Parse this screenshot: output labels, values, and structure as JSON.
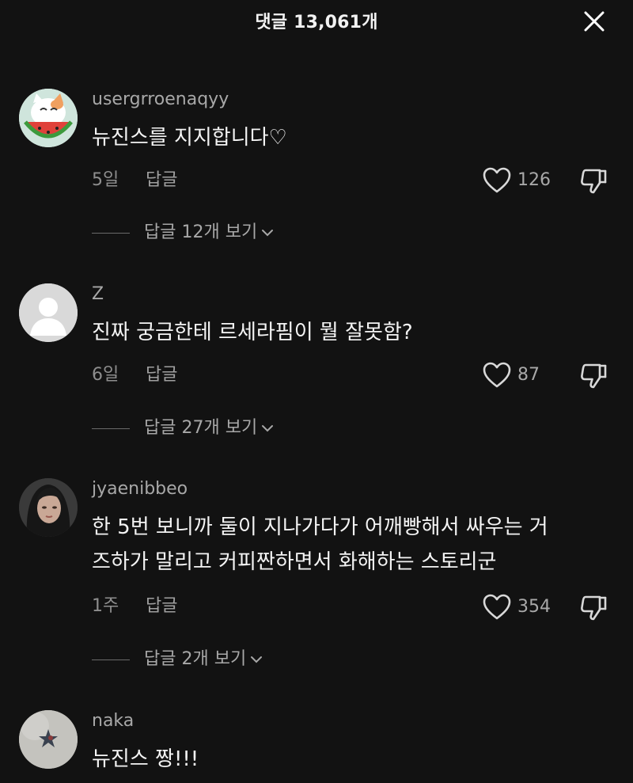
{
  "header": {
    "title": "댓글 13,061개"
  },
  "comments": [
    {
      "username": "usergrroenaqyy",
      "avatar": "watermelon-cat-icon",
      "text": "뉴진스를 지지합니다♡",
      "time": "5일",
      "reply_label": "답글",
      "likes": "126",
      "view_replies": "답글 12개 보기"
    },
    {
      "username": "Z",
      "avatar": "default-user-icon",
      "text": "진짜 궁금한테 르세라핌이 뭘 잘못함?",
      "time": "6일",
      "reply_label": "답글",
      "likes": "87",
      "view_replies": "답글 27개 보기"
    },
    {
      "username": "jyaenibbeo",
      "avatar": "profile-photo",
      "text": "한 5번 보니까 둘이 지나가다가 어깨빵해서 싸우는 거즈하가 말리고 커피짠하면서 화해하는 스토리군",
      "text_line1": "한 5번 보니까 둘이 지나가다가 어깨빵해서 싸우는 거",
      "text_line2": "즈하가 말리고 커피짠하면서 화해하는 스토리군",
      "time": "1주",
      "reply_label": "답글",
      "likes": "354",
      "view_replies": "답글 2개 보기"
    },
    {
      "username": "naka",
      "avatar": "star-sticker-photo",
      "text": "뉴진스 짱!!!"
    }
  ],
  "colors": {
    "background": "#121212",
    "text_primary": "#f4f4f4",
    "text_secondary": "#a8a8a8"
  }
}
